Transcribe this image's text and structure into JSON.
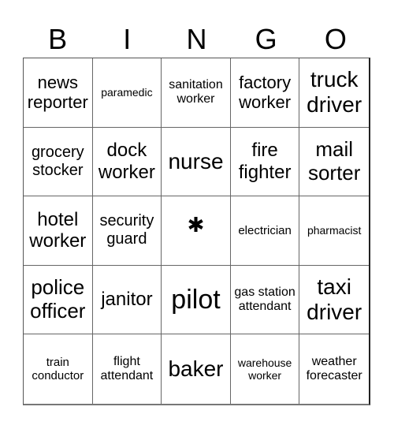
{
  "header": {
    "letters": [
      "B",
      "I",
      "N",
      "G",
      "O"
    ]
  },
  "cells": [
    {
      "text": "news reporter",
      "size": "s22"
    },
    {
      "text": "paramedic",
      "size": "s14"
    },
    {
      "text": "sanitation worker",
      "size": "s16"
    },
    {
      "text": "factory worker",
      "size": "s22"
    },
    {
      "text": "truck driver",
      "size": "s28"
    },
    {
      "text": "grocery stocker",
      "size": "s20"
    },
    {
      "text": "dock worker",
      "size": "s24"
    },
    {
      "text": "nurse",
      "size": "s28"
    },
    {
      "text": "fire fighter",
      "size": "s24"
    },
    {
      "text": "mail sorter",
      "size": "s26"
    },
    {
      "text": "hotel worker",
      "size": "s24"
    },
    {
      "text": "security guard",
      "size": "s20"
    },
    {
      "text": "✱",
      "size": "star",
      "free": true
    },
    {
      "text": "electrician",
      "size": "s15"
    },
    {
      "text": "pharmacist",
      "size": "s14"
    },
    {
      "text": "police officer",
      "size": "s26"
    },
    {
      "text": "janitor",
      "size": "s24"
    },
    {
      "text": "pilot",
      "size": "s34"
    },
    {
      "text": "gas station attendant",
      "size": "s16"
    },
    {
      "text": "taxi driver",
      "size": "s28"
    },
    {
      "text": "train conductor",
      "size": "s15"
    },
    {
      "text": "flight attendant",
      "size": "s16"
    },
    {
      "text": "baker",
      "size": "s28"
    },
    {
      "text": "warehouse worker",
      "size": "s14"
    },
    {
      "text": "weather forecaster",
      "size": "s16"
    }
  ]
}
